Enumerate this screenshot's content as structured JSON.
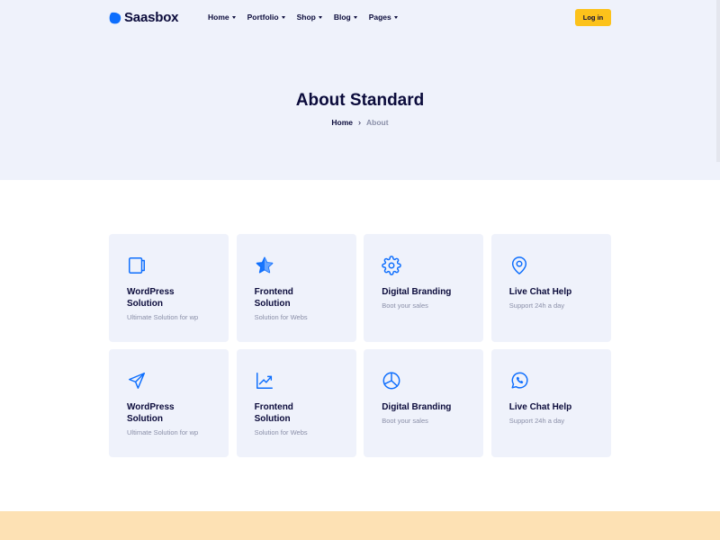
{
  "brand": {
    "name": "Saasbox",
    "color": "#0d6efd"
  },
  "nav": {
    "items": [
      {
        "label": "Home"
      },
      {
        "label": "Portfolio"
      },
      {
        "label": "Shop"
      },
      {
        "label": "Blog"
      },
      {
        "label": "Pages"
      }
    ],
    "login_label": "Log in"
  },
  "hero": {
    "title": "About Standard",
    "breadcrumb": {
      "home": "Home",
      "separator": "›",
      "current": "About"
    }
  },
  "cards": [
    {
      "icon": "tablet-icon",
      "title": "WordPress Solution",
      "subtitle": "Ultimate Solution for wp"
    },
    {
      "icon": "star-icon",
      "title": "Frontend Solution",
      "subtitle": "Solution for Webs"
    },
    {
      "icon": "gear-icon",
      "title": "Digital Branding",
      "subtitle": "Boot your sales"
    },
    {
      "icon": "map-pin-icon",
      "title": "Live Chat Help",
      "subtitle": "Support 24h a day"
    },
    {
      "icon": "send-icon",
      "title": "WordPress Solution",
      "subtitle": "Ultimate Solution for wp"
    },
    {
      "icon": "trending-up-icon",
      "title": "Frontend Solution",
      "subtitle": "Solution for Webs"
    },
    {
      "icon": "pie-chart-icon",
      "title": "Digital Branding",
      "subtitle": "Boot your sales"
    },
    {
      "icon": "whatsapp-icon",
      "title": "Live Chat Help",
      "subtitle": "Support 24h a day"
    }
  ],
  "colors": {
    "accent": "#0d6efd",
    "button": "#fcc21b",
    "hero_bg": "#eff2fb",
    "footer_band": "#fde1b4",
    "text": "#0b0b3b",
    "muted": "#8a8fa8"
  }
}
